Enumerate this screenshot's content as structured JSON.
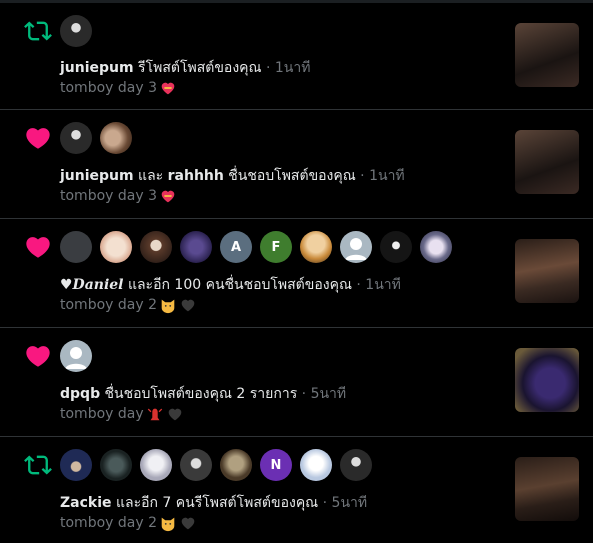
{
  "notifications": [
    {
      "kind": "repost",
      "who": "juniepum",
      "action": " รีโพสต์โพสต์ของคุณ",
      "time": " · 1นาที",
      "post_text": "tomboy day 3",
      "icon": "repost-icon",
      "avatars": [
        {
          "type": "img",
          "tone": "#2a2a2a"
        }
      ],
      "thumb_tone": "#3b2a24"
    },
    {
      "kind": "like",
      "who": "juniepum",
      "action_mid": " และ ",
      "who2": "rahhhh",
      "action": " ชื่นชอบโพสต์ของคุณ",
      "time": " · 1นาที",
      "post_text": "tomboy day 3",
      "icon": "heart-icon",
      "avatars": [
        {
          "type": "img",
          "tone": "#2a2a2a"
        },
        {
          "type": "img",
          "tone": "#8a6a55"
        }
      ],
      "thumb_tone": "#3b2a24"
    },
    {
      "kind": "like",
      "who": "♥𝑫𝒂𝒏𝒊𝒆𝒍",
      "action": " และอีก 100 คนชื่นชอบโพสต์ของคุณ",
      "time": " · 1นาที",
      "post_text": "tomboy day 2",
      "icon": "heart-icon",
      "avatars": [
        {
          "type": "plain",
          "tone": "#3a3d41"
        },
        {
          "type": "img",
          "tone": "#d9b8a0"
        },
        {
          "type": "img",
          "tone": "#5a3a2a"
        },
        {
          "type": "img",
          "tone": "#2b2250"
        },
        {
          "type": "letter",
          "letter": "A",
          "tone": "#5b6e7f"
        },
        {
          "type": "letter",
          "letter": "F",
          "tone": "#3f7d2e"
        },
        {
          "type": "img",
          "tone": "#c98a3a"
        },
        {
          "type": "default",
          "tone": "#aab8c2"
        },
        {
          "type": "img",
          "tone": "#151515"
        },
        {
          "type": "img",
          "tone": "#6a6a8a"
        }
      ],
      "thumb_tone": "#4a3a30"
    },
    {
      "kind": "like",
      "who": "dpqb",
      "action": " ชื่นชอบโพสต์ของคุณ 2 รายการ",
      "time": " · 5นาที",
      "post_text": "tomboy day",
      "icon": "heart-icon",
      "avatars": [
        {
          "type": "default",
          "tone": "#aab8c2"
        }
      ],
      "thumb_tone": "#3a2a55"
    },
    {
      "kind": "repost",
      "who": "Zackie",
      "action": " และอีก 7 คนรีโพสต์โพสต์ของคุณ",
      "time": " · 5นาที",
      "post_text": "tomboy day 2",
      "icon": "repost-icon",
      "avatars": [
        {
          "type": "img",
          "tone": "#1f2a55"
        },
        {
          "type": "img",
          "tone": "#2f3a3a"
        },
        {
          "type": "img",
          "tone": "#c8c8d0"
        },
        {
          "type": "img",
          "tone": "#3a3a3a"
        },
        {
          "type": "img",
          "tone": "#6a5a40"
        },
        {
          "type": "letter",
          "letter": "N",
          "tone": "#6b2fb3"
        },
        {
          "type": "img",
          "tone": "#b8c8e0"
        },
        {
          "type": "img",
          "tone": "#2a2a2a"
        }
      ],
      "thumb_tone": "#3a2a24"
    }
  ],
  "colors": {
    "repost": "#00ba7c",
    "like": "#f91880",
    "muted": "#71767b",
    "divider": "#2f3336"
  }
}
